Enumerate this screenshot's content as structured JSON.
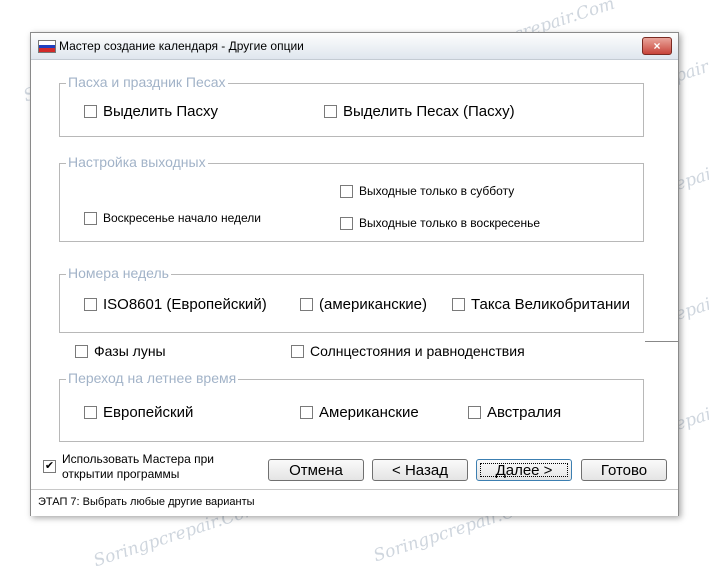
{
  "window": {
    "title": "Мастер создание календаря - Другие опции",
    "close_label": "×",
    "close_icon": "close-icon",
    "flag_colors": [
      "#ffffff",
      "#1f3fbf",
      "#d22a2a"
    ]
  },
  "easter_group": {
    "legend": "Пасха и праздник Песах",
    "items": [
      {
        "label": "Выделить Пасху",
        "checked": false
      },
      {
        "label": "Выделить Песах (Пасху)",
        "checked": false
      }
    ]
  },
  "weekend_group": {
    "legend": "Настройка выходных",
    "items": [
      {
        "label": "Выходные только в субботу",
        "checked": false
      },
      {
        "label": "Воскресенье начало недели",
        "checked": false
      },
      {
        "label": "Выходные только в воскресенье",
        "checked": false
      }
    ]
  },
  "weeknum_group": {
    "legend": "Номера недель",
    "items": [
      {
        "label": "ISO8601 (Европейский)",
        "checked": false
      },
      {
        "label": "(американские)",
        "checked": false
      },
      {
        "label": "Такса Великобритании",
        "checked": false
      }
    ]
  },
  "extra_options": [
    {
      "label": "Фазы луны",
      "checked": false
    },
    {
      "label": "Солнцестояния и равноденствия",
      "checked": false
    }
  ],
  "dst_group": {
    "legend": "Переход на летнее время",
    "items": [
      {
        "label": "Европейский",
        "checked": false
      },
      {
        "label": "Американские",
        "checked": false
      },
      {
        "label": "Австралия",
        "checked": false
      }
    ]
  },
  "use_wizard": {
    "line1": "Использовать Мастера при",
    "line2": "открытии программы",
    "checked": true,
    "check_mark": "✔"
  },
  "buttons": {
    "cancel": "Отмена",
    "back": "< Назад",
    "next": "Далее >",
    "finish": "Готово"
  },
  "status": "ЭТАП 7: Выбрать любые другие варианты",
  "watermark": "Soringpcrepair.Com",
  "colors": {
    "legend_text": "#a2b3c8",
    "group_border": "#b8b8b8",
    "focus_border": "#3c7fb1"
  }
}
